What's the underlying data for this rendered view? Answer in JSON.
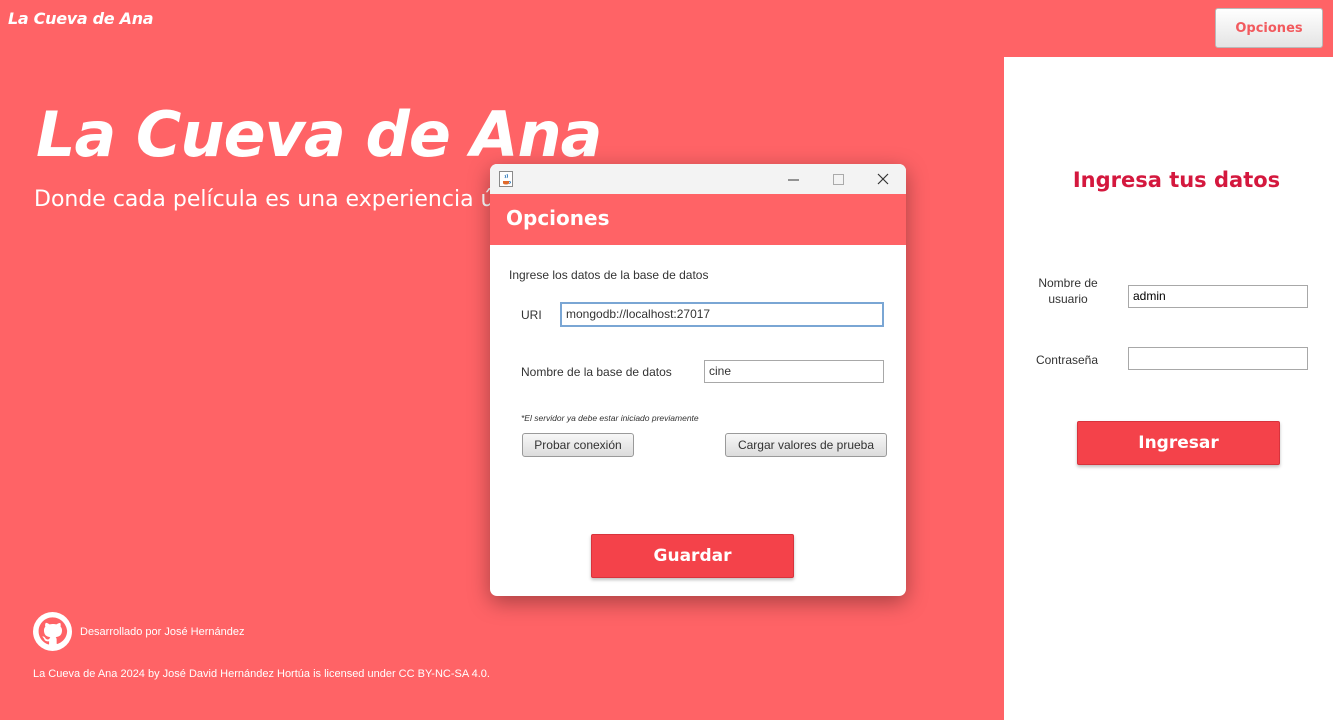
{
  "app": {
    "title": "La Cueva de Ana",
    "options_button": "Opciones"
  },
  "hero": {
    "title": "La Cueva de Ana",
    "subtitle": "Donde cada película es una experiencia úni"
  },
  "footer": {
    "developer": "Desarrollado por José Hernández",
    "license": "La Cueva de Ana 2024 by José David Hernández Hortúa is licensed under CC BY-NC-SA 4.0."
  },
  "login": {
    "heading": "Ingresa tus datos",
    "username_label": "Nombre de usuario",
    "username_value": "admin",
    "password_label": "Contraseña",
    "password_value": "",
    "submit_label": "Ingresar"
  },
  "dialog": {
    "window_controls": [
      "minimize-icon",
      "maximize-icon",
      "close-icon"
    ],
    "header_title": "Opciones",
    "intro": "Ingrese los datos de la base de datos",
    "uri_label": "URI",
    "uri_value": "mongodb://localhost:27017",
    "db_label": "Nombre de la base de datos",
    "db_value": "cine",
    "note": "*El servidor ya debe estar iniciado previamente",
    "test_button": "Probar conexión",
    "load_button": "Cargar valores de prueba",
    "save_button": "Guardar"
  },
  "colors": {
    "background": "#ff6366",
    "accent_button": "#f4424a",
    "heading_red": "#d4183e"
  }
}
